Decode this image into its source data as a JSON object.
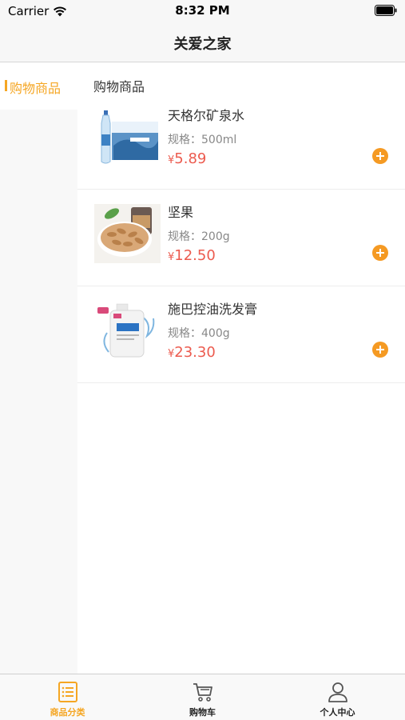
{
  "status_bar": {
    "carrier": "Carrier",
    "time": "8:32 PM"
  },
  "nav": {
    "title": "关爱之家"
  },
  "sidebar": {
    "items": [
      {
        "label": "购物商品",
        "active": true
      }
    ]
  },
  "content": {
    "section_title": "购物商品",
    "products": [
      {
        "name": "天格尔矿泉水",
        "spec": "规格：500ml",
        "currency": "¥",
        "price": "5.89",
        "image": "water-bottle-image"
      },
      {
        "name": "坚果",
        "spec": "规格：200g",
        "currency": "¥",
        "price": "12.50",
        "image": "nuts-image"
      },
      {
        "name": "施巴控油洗发膏",
        "spec": "规格：400g",
        "currency": "¥",
        "price": "23.30",
        "image": "shampoo-image"
      }
    ]
  },
  "tab_bar": {
    "tabs": [
      {
        "label": "商品分类",
        "icon": "list-icon",
        "active": true
      },
      {
        "label": "购物车",
        "icon": "cart-icon",
        "active": false
      },
      {
        "label": "个人中心",
        "icon": "person-icon",
        "active": false
      }
    ]
  },
  "colors": {
    "accent": "#f5a623",
    "price": "#ec5b4f",
    "add_button": "#f59a23"
  }
}
